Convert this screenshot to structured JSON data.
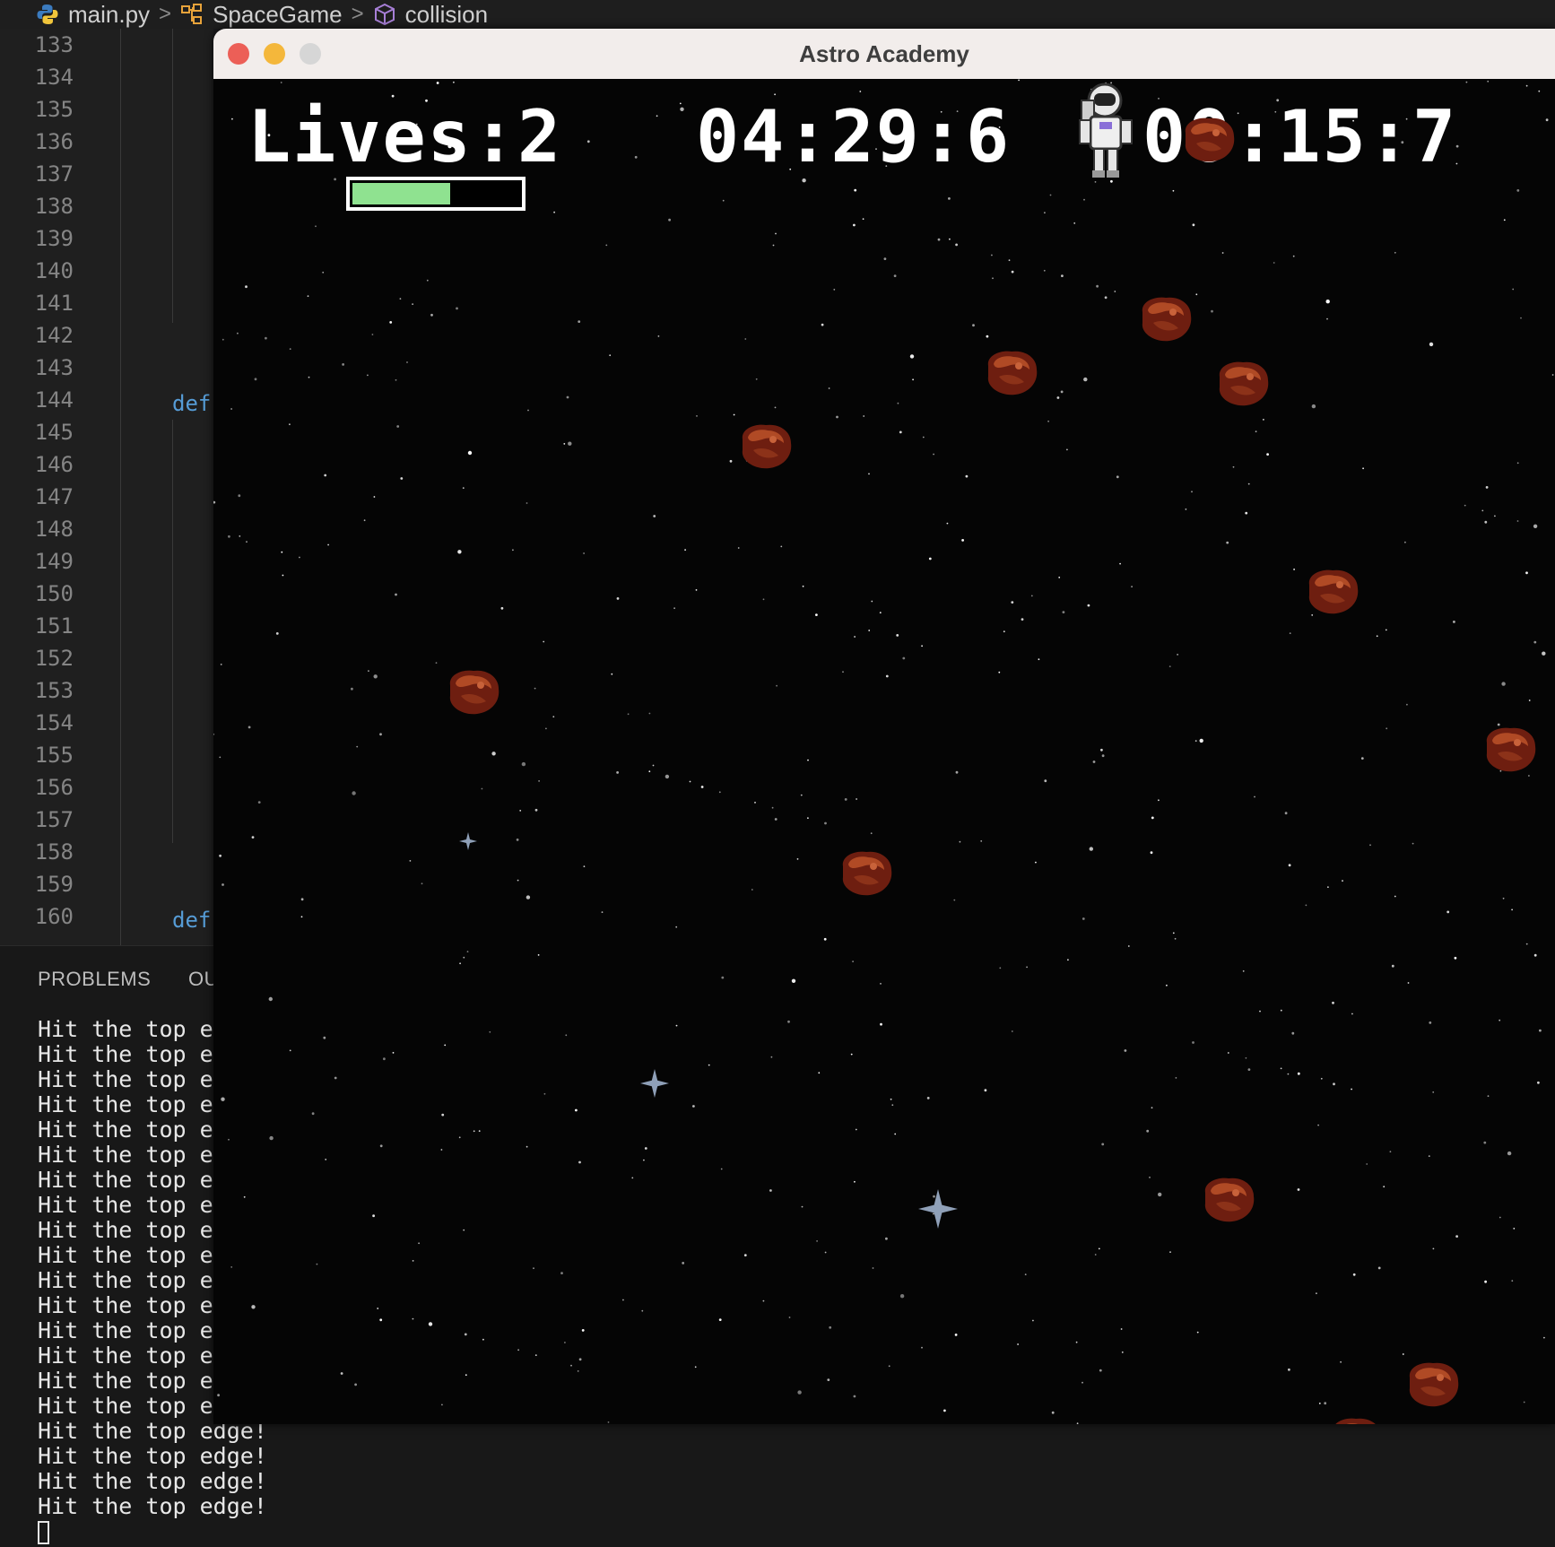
{
  "breadcrumb": {
    "file": "main.py",
    "class": "SpaceGame",
    "method": "collision"
  },
  "editor": {
    "line_numbers": [
      "133",
      "134",
      "135",
      "136",
      "137",
      "138",
      "139",
      "140",
      "141",
      "142",
      "143",
      "144",
      "145",
      "146",
      "147",
      "148",
      "149",
      "150",
      "151",
      "152",
      "153",
      "154",
      "155",
      "156",
      "157",
      "158",
      "159",
      "160"
    ],
    "keywords": [
      {
        "line": "144",
        "text": "def"
      },
      {
        "line": "160",
        "text": "def"
      }
    ]
  },
  "panel": {
    "tabs": [
      "PROBLEMS",
      "OU"
    ],
    "output_lines_truncated": [
      "Hit the top ed",
      "Hit the top ed",
      "Hit the top ed",
      "Hit the top ed",
      "Hit the top ed",
      "Hit the top ed",
      "Hit the top ed",
      "Hit the top ed",
      "Hit the top ed",
      "Hit the top ed",
      "Hit the top ed",
      "Hit the top ed",
      "Hit the top ed",
      "Hit the top ed",
      "Hit the top ed",
      "Hit the top ed"
    ],
    "output_lines_full": [
      "Hit the top edge!",
      "Hit the top edge!",
      "Hit the top edge!",
      "Hit the top edge!"
    ]
  },
  "window": {
    "title": "Astro Academy",
    "traffic_lights": {
      "close": "#ec5f57",
      "minimize": "#f4b73b",
      "zoom": "#d6d6d6"
    }
  },
  "game": {
    "lives_text": "Lives:2",
    "timer_left": "04:29:6",
    "timer_right": "00:15:7",
    "health_fraction": 0.6,
    "health_color": "#8fe290",
    "player_icon": "astronaut-icon",
    "obstacle_icon": "asteroid-icon"
  }
}
